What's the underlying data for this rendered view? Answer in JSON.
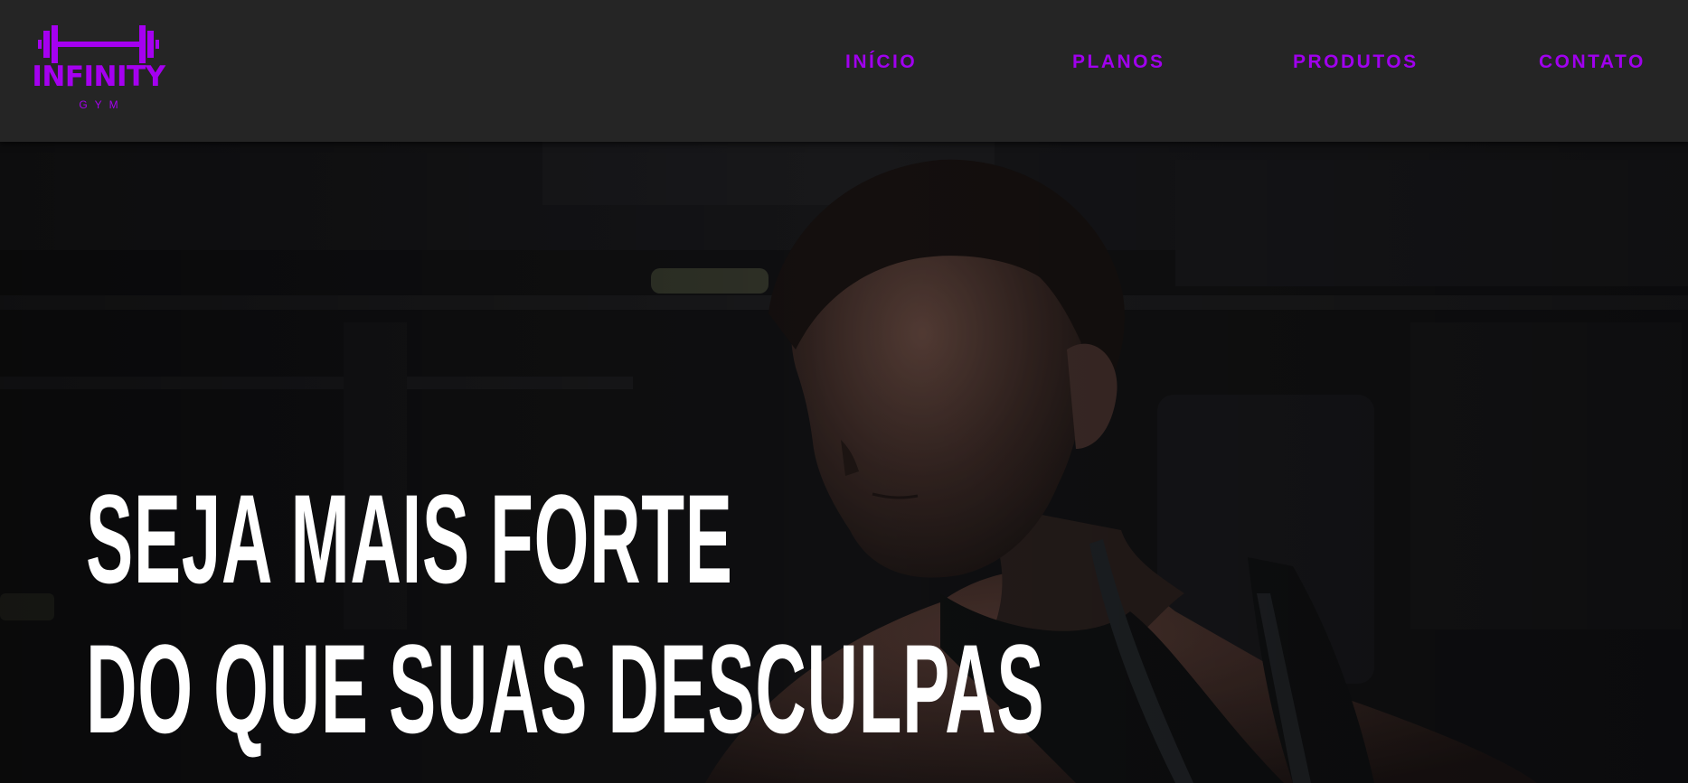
{
  "brand": {
    "name": "INFINITY",
    "tagline": "GYM",
    "logo_icon": "barbell-icon",
    "color": "#a500f0"
  },
  "nav": {
    "items": [
      {
        "label": "INÍCIO"
      },
      {
        "label": "PLANOS"
      },
      {
        "label": "PRODUTOS"
      },
      {
        "label": "CONTATO"
      }
    ]
  },
  "hero": {
    "line1": "SEJA MAIS FORTE",
    "line2": "DO QUE SUAS DESCULPAS",
    "image": "man-lifting-photo"
  },
  "colors": {
    "navbar_bg": "#252525",
    "accent": "#a000ee",
    "hero_text": "#ffffff",
    "hero_bg": "#121213"
  }
}
